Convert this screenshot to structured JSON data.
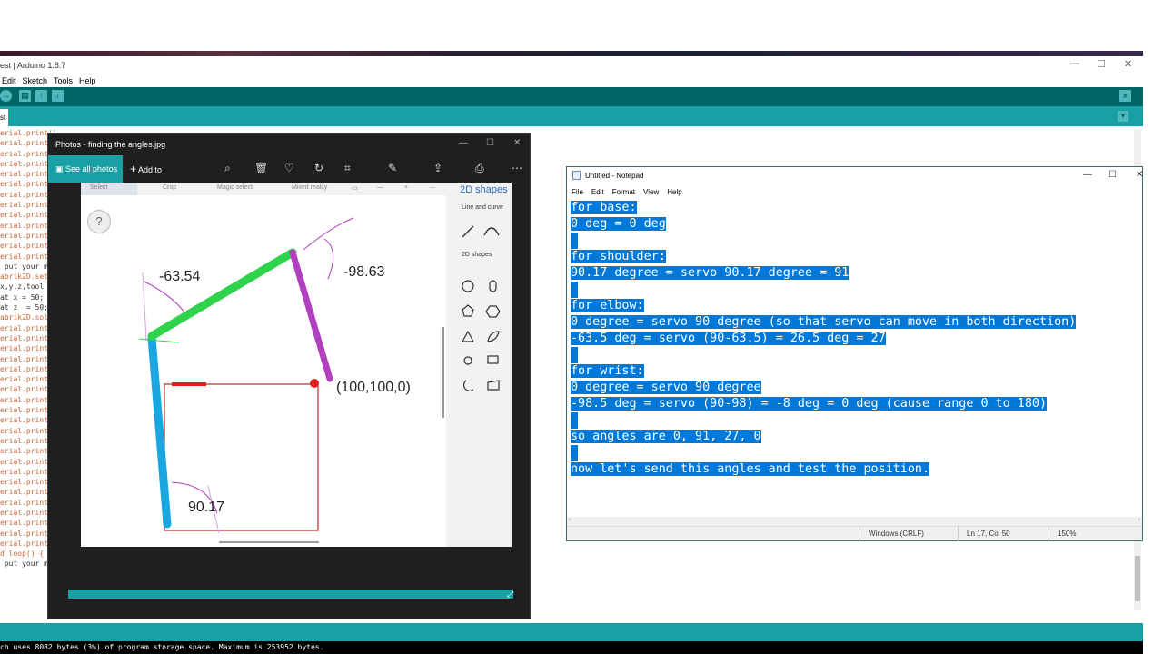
{
  "arduino": {
    "title": "est | Arduino 1.8.7",
    "menu": [
      "Edit",
      "Sketch",
      "Tools",
      "Help"
    ],
    "tab_label": "st",
    "win_minimize": "—",
    "win_maximize": "☐",
    "win_close": "✕",
    "code_lines": [
      "erial.print(\"x1\");",
      "erial.print(",
      "erial.print(",
      "erial.print(",
      "erial.print(",
      "erial.print(",
      "erial.print(",
      "erial.print(",
      "erial.print(",
      "erial.print(",
      "erial.print(",
      "erial.print(",
      "erial.printl",
      " put your m",
      "abrik2D.setT",
      "x,y,z,tool",
      "at x = 50;",
      "at z  = 50;",
      "abrik2D.solv",
      "erial.print(",
      "erial.print(",
      "erial.print(",
      "erial.print(",
      "erial.print(",
      "erial.print(",
      "erial.print(",
      "erial.print(",
      "erial.print(",
      "erial.print(",
      "erial.print(",
      "erial.print(",
      "erial.print(",
      "erial.print(",
      "erial.print(",
      "erial.print(",
      "erial.print(",
      "erial.print(",
      "erial.print(",
      "erial.print(",
      "erial.print(",
      "erial.printl",
      "",
      "",
      "d loop() {",
      " put your m"
    ],
    "console_text": "ch uses 8082 bytes (3%) of program storage space. Maximum is 253952 bytes."
  },
  "photos": {
    "title": "Photos - finding the angles.jpg",
    "see_all_photos": "See all photos",
    "add_to": "Add to",
    "toolbar_icons": [
      "zoom-icon",
      "delete-icon",
      "heart-icon",
      "rotate-icon",
      "crop-icon",
      "edit-icon",
      "share-icon",
      "print-icon",
      "more-icon"
    ],
    "inner_toolbar": [
      "Select",
      "Crop",
      "Magic select",
      "Mixed reality"
    ],
    "side_title": "2D shapes",
    "side_line_and_curve": "Line and curve",
    "side_2d_shapes": "2D shapes",
    "help": "?",
    "labels": {
      "angle_shoulder": "-63.54",
      "angle_wrist": "-98.63",
      "target": "(100,100,0)",
      "angle_base": "90.17"
    },
    "colors": {
      "upper_arm": "#1aa6e0",
      "forearm": "#2dd34a",
      "hand": "#b23fc0",
      "box": "#b22a2a",
      "target": "#e02020"
    }
  },
  "notepad": {
    "title": "Untitled - Notepad",
    "menu": [
      "File",
      "Edit",
      "Format",
      "View",
      "Help"
    ],
    "lines": [
      "for base:",
      "0 deg = 0 deg",
      "",
      "for shoulder:",
      "90.17 degree = servo 90.17 degree = 91",
      "",
      "for elbow:",
      "0 degree = servo 90 degree (so that servo can move in both direction)",
      "-63.5 deg = servo (90-63.5) = 26.5 deg = 27",
      "",
      "for wrist:",
      "0 degree = servo 90 degree",
      "-98.5 deg = servo (90-98) = -8 deg = 0 deg (cause range 0 to 180)",
      "",
      "so angles are 0, 91, 27, 0",
      "",
      "now let's send this angles and test the position."
    ],
    "status": {
      "line_ending": "Windows (CRLF)",
      "position": "Ln 17, Col 50",
      "zoom": "150%"
    }
  }
}
